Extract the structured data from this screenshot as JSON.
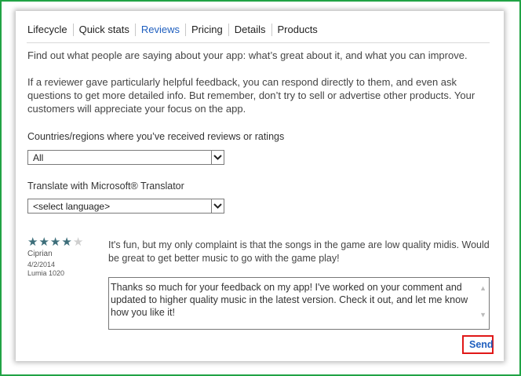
{
  "tabs": [
    {
      "label": "Lifecycle"
    },
    {
      "label": "Quick stats"
    },
    {
      "label": "Reviews",
      "active": true
    },
    {
      "label": "Pricing"
    },
    {
      "label": "Details"
    },
    {
      "label": "Products"
    }
  ],
  "intro": {
    "line1": "Find out what people are saying about your app: what’s great about it, and what you can improve.",
    "line2": "If a reviewer gave particularly helpful feedback, you can respond directly to them, and even ask questions to get more detailed info. But remember, don’t try to sell or advertise other products. Your customers will appreciate your focus on the app."
  },
  "filters": {
    "countries_label": "Countries/regions where you’ve received reviews or ratings",
    "countries_value": "All",
    "translate_label": "Translate with Microsoft® Translator",
    "translate_value": "<select language>"
  },
  "review": {
    "rating": 4,
    "max_rating": 5,
    "author": "Ciprian",
    "date": "4/2/2014",
    "device": "Lumia 1020",
    "text": "It's fun, but my only complaint is that the songs in the game are low quality midis. Would be great to get better music to go with the game play!",
    "reply": "Thanks so much for your feedback on my app! I've worked on your comment and updated to higher quality music in the latest version. Check it out, and let me know how you like it!",
    "send_label": "Send"
  },
  "colors": {
    "frame_border": "#21a345",
    "active_tab": "#1f5fbf",
    "star_filled": "#3d6e7a",
    "star_empty": "#cfcfcf",
    "send_highlight": "#e01818"
  }
}
